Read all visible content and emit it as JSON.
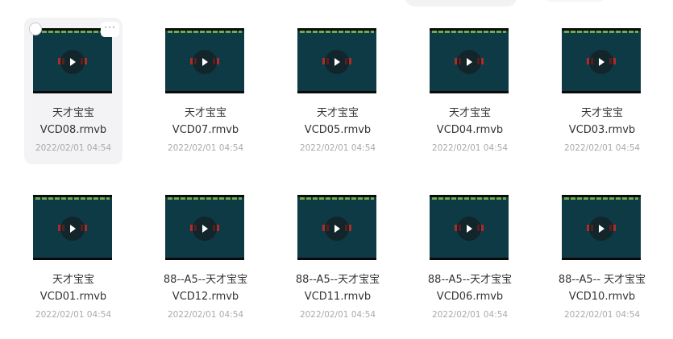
{
  "files": [
    {
      "name_line1": "天才宝宝",
      "name_line2": "VCD08.rmvb",
      "date": "2022/02/01 04:54",
      "selected": true
    },
    {
      "name_line1": "天才宝宝",
      "name_line2": "VCD07.rmvb",
      "date": "2022/02/01 04:54",
      "selected": false
    },
    {
      "name_line1": "天才宝宝",
      "name_line2": "VCD05.rmvb",
      "date": "2022/02/01 04:54",
      "selected": false
    },
    {
      "name_line1": "天才宝宝",
      "name_line2": "VCD04.rmvb",
      "date": "2022/02/01 04:54",
      "selected": false
    },
    {
      "name_line1": "天才宝宝",
      "name_line2": "VCD03.rmvb",
      "date": "2022/02/01 04:54",
      "selected": false
    },
    {
      "name_line1": "天才宝宝",
      "name_line2": "VCD01.rmvb",
      "date": "2022/02/01 04:54",
      "selected": false
    },
    {
      "name_line1": "88--A5--天才宝宝",
      "name_line2": "VCD12.rmvb",
      "date": "2022/02/01 04:54",
      "selected": false
    },
    {
      "name_line1": "88--A5--天才宝宝",
      "name_line2": "VCD11.rmvb",
      "date": "2022/02/01 04:54",
      "selected": false
    },
    {
      "name_line1": "88--A5--天才宝宝",
      "name_line2": "VCD06.rmvb",
      "date": "2022/02/01 04:54",
      "selected": false
    },
    {
      "name_line1": "88--A5-- 天才宝宝",
      "name_line2": "VCD10.rmvb",
      "date": "2022/02/01 04:54",
      "selected": false
    }
  ],
  "card_actions": {
    "more_label": "···"
  },
  "icons": {
    "thumbnail": "video-thumbnail",
    "play": "play-icon",
    "select": "checkbox-circle-icon",
    "more": "more-options-icon"
  },
  "colors": {
    "thumbnail_bg": "#0e3a46",
    "selected_card_bg": "#f3f3f5",
    "name_text": "#333333",
    "date_text": "#aaaaaf"
  }
}
